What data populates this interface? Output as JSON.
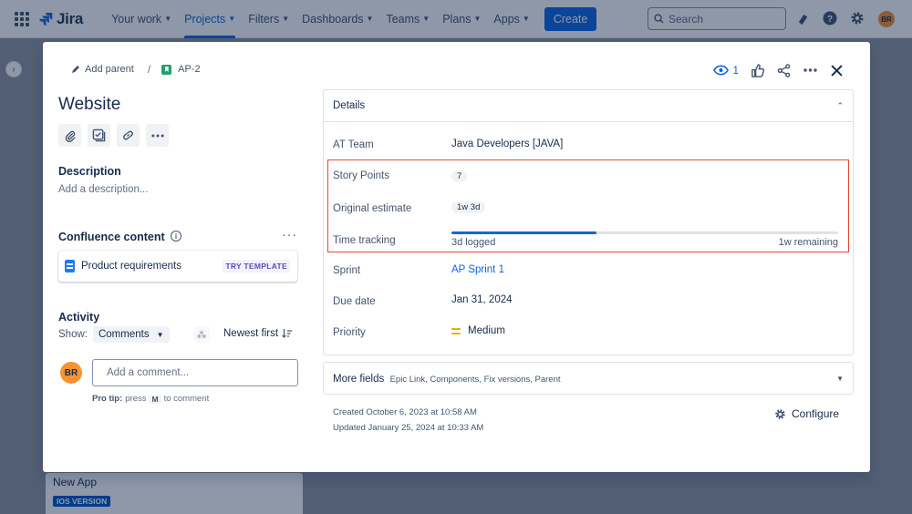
{
  "nav": {
    "brand": "Jira",
    "items": [
      {
        "label": "Your work",
        "active": false
      },
      {
        "label": "Projects",
        "active": true
      },
      {
        "label": "Filters",
        "active": false
      },
      {
        "label": "Dashboards",
        "active": false
      },
      {
        "label": "Teams",
        "active": false
      },
      {
        "label": "Plans",
        "active": false
      },
      {
        "label": "Apps",
        "active": false
      }
    ],
    "create_label": "Create",
    "search_placeholder": "Search",
    "avatar_initials": "BR"
  },
  "board": {
    "card_title": "New App",
    "card_badge": "IOS VERSION"
  },
  "modal": {
    "add_parent_label": "Add parent",
    "breadcrumb_sep": "/",
    "issue_key": "AP-2",
    "watch_count": "1",
    "title": "Website",
    "description_heading": "Description",
    "description_placeholder": "Add a description...",
    "confluence_heading": "Confluence content",
    "confluence_item": "Product requirements",
    "try_template": "TRY TEMPLATE",
    "activity_heading": "Activity",
    "show_label": "Show:",
    "show_value": "Comments",
    "sort_label": "Newest first",
    "comment_avatar": "BR",
    "comment_placeholder": "Add a comment...",
    "protip_bold": "Pro tip:",
    "protip_press": "press",
    "protip_key": "M",
    "protip_rest": "to comment"
  },
  "details": {
    "heading": "Details",
    "fields": {
      "team_label": "AT Team",
      "team_value": "Java Developers [JAVA]",
      "story_points_label": "Story Points",
      "story_points_value": "7",
      "estimate_label": "Original estimate",
      "estimate_value": "1w 3d",
      "tracking_label": "Time tracking",
      "tracking_logged": "3d logged",
      "tracking_remaining": "1w remaining",
      "tracking_progress": 0.375,
      "sprint_label": "Sprint",
      "sprint_value": "AP Sprint 1",
      "due_label": "Due date",
      "due_value": "Jan 31, 2024",
      "priority_label": "Priority",
      "priority_value": "Medium"
    },
    "more_fields_title": "More fields",
    "more_fields_sub": "Epic Link, Components, Fix versions, Parent",
    "created": "Created October 6, 2023 at 10:58 AM",
    "updated": "Updated January 25, 2024 at 10:33 AM",
    "configure_label": "Configure"
  },
  "colors": {
    "accent": "#0c66e4",
    "highlight_border": "#e34935",
    "avatar": "#f79232",
    "story_type": "#22a06b",
    "priority_medium": "#e2b203"
  }
}
